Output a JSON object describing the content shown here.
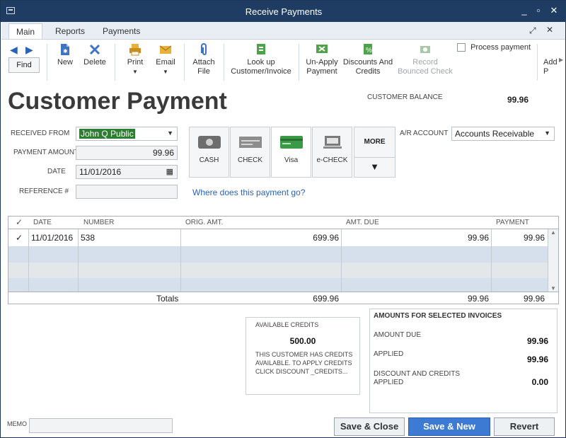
{
  "window": {
    "title": "Receive Payments"
  },
  "ribbon": {
    "tabs": [
      "Main",
      "Reports",
      "Payments"
    ],
    "find_label": "Find",
    "tools": {
      "new": "New",
      "delete": "Delete",
      "print": "Print",
      "email": "Email",
      "attach_line1": "Attach",
      "attach_line2": "File",
      "lookup_line1": "Look up",
      "lookup_line2": "Customer/Invoice",
      "unapply_line1": "Un-Apply",
      "unapply_line2": "Payment",
      "discounts_line1": "Discounts And",
      "discounts_line2": "Credits",
      "record_line1": "Record",
      "record_line2": "Bounced Check",
      "process_payment": "Process payment",
      "overflow_line1": "Add",
      "overflow_line2": "P"
    }
  },
  "form": {
    "heading": "Customer Payment",
    "customer_balance_label": "CUSTOMER BALANCE",
    "customer_balance_value": "99.96",
    "received_from_label": "RECEIVED FROM",
    "received_from_value": "John Q Public",
    "payment_amount_label": "PAYMENT AMOUNT",
    "payment_amount_value": "99.96",
    "date_label": "DATE",
    "date_value": "11/01/2016",
    "reference_label": "REFERENCE #",
    "reference_value": "",
    "payment_methods": [
      "CASH",
      "CHECK",
      "Visa",
      "e-CHECK"
    ],
    "more_label": "MORE",
    "where_link": "Where does this payment go?",
    "ar_account_label": "A/R ACCOUNT",
    "ar_account_value": "Accounts Receivable"
  },
  "table": {
    "columns": [
      "✓",
      "DATE",
      "NUMBER",
      "ORIG. AMT.",
      "AMT. DUE",
      "PAYMENT"
    ],
    "rows": [
      {
        "check": "✓",
        "date": "11/01/2016",
        "number": "538",
        "orig": "699.96",
        "due": "99.96",
        "payment": "99.96"
      }
    ],
    "totals_label": "Totals",
    "totals_orig": "699.96",
    "totals_due": "99.96",
    "totals_payment": "99.96"
  },
  "credits": {
    "title": "AVAILABLE CREDITS",
    "amount": "500.00",
    "message_line1": "THIS CUSTOMER HAS CREDITS",
    "message_line2": "AVAILABLE. TO APPLY CREDITS",
    "message_line3": "CLICK DISCOUNT _CREDITS..."
  },
  "amounts": {
    "title": "AMOUNTS FOR SELECTED INVOICES",
    "amount_due_label": "AMOUNT DUE",
    "amount_due_value": "99.96",
    "applied_label": "APPLIED",
    "applied_value": "99.96",
    "discount_label_line1": "DISCOUNT AND CREDITS",
    "discount_label_line2": "APPLIED",
    "discount_value": "0.00"
  },
  "footer": {
    "memo_label": "MEMO",
    "memo_value": "",
    "save_close": "Save & Close",
    "save_new": "Save & New",
    "revert": "Revert"
  },
  "colors": {
    "titlebar": "#1f3d63",
    "accent": "#3d7ad4",
    "highlight": "#2e7d32",
    "link": "#2a63b5"
  }
}
